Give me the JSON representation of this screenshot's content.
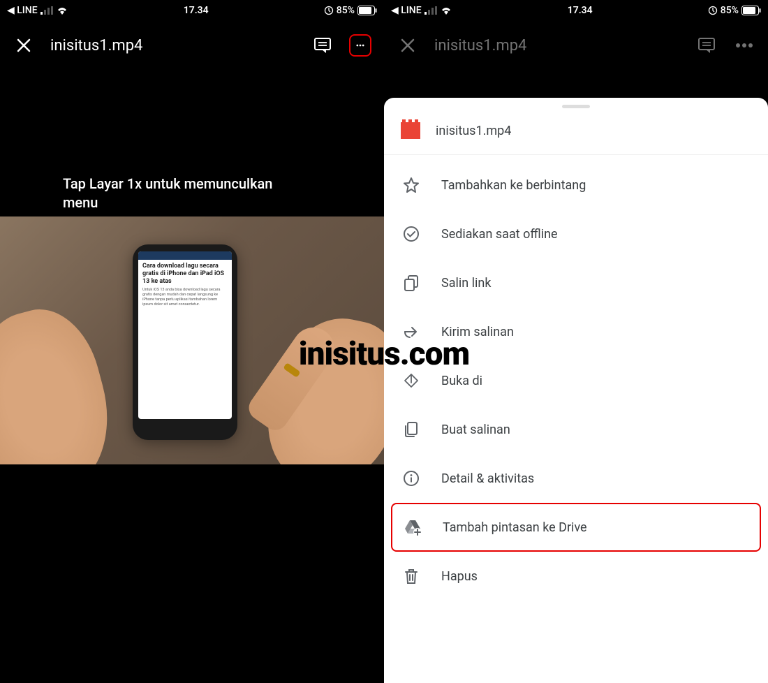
{
  "status_bar": {
    "back_app": "LINE",
    "time": "17.34",
    "battery_pct": "85%"
  },
  "header": {
    "filename": "inisitus1.mp4"
  },
  "left_pane": {
    "caption": "Tap Layar 1x untuk memunculkan menu",
    "phone_title": "Cara download lagu secara gratis di iPhone dan iPad iOS 13 ke atas"
  },
  "sheet": {
    "filename": "inisitus1.mp4",
    "items": [
      {
        "icon": "star",
        "label": "Tambahkan ke berbintang"
      },
      {
        "icon": "offline",
        "label": "Sediakan saat offline"
      },
      {
        "icon": "link",
        "label": "Salin link"
      },
      {
        "icon": "send",
        "label": "Kirim salinan"
      },
      {
        "icon": "open",
        "label": "Buka di"
      },
      {
        "icon": "copy",
        "label": "Buat salinan"
      },
      {
        "icon": "info",
        "label": "Detail & aktivitas"
      },
      {
        "icon": "drive",
        "label": "Tambah pintasan ke Drive"
      },
      {
        "icon": "trash",
        "label": "Hapus"
      }
    ]
  },
  "watermark": "inisitus.com"
}
